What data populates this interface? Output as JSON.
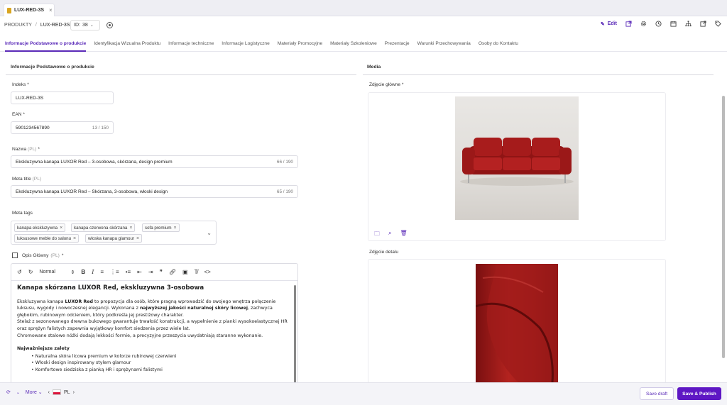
{
  "doc_tab": {
    "label": "LUX-RED-3S",
    "close": "×"
  },
  "breadcrumb": {
    "root": "PRODUKTY",
    "sep": "/",
    "current": "LUX-RED-3S"
  },
  "id_select": {
    "label": "ID:",
    "value": "38"
  },
  "toolbar": {
    "edit_label": "Edit"
  },
  "tabs": [
    {
      "label": "Informacje Podstawowe o produkcie",
      "active": true
    },
    {
      "label": "Identyfikacja Wizualna Produktu"
    },
    {
      "label": "Informacje techniczne"
    },
    {
      "label": "Informacje Logistyczne"
    },
    {
      "label": "Materiały Promocyjne"
    },
    {
      "label": "Materiały Szkoleniowe"
    },
    {
      "label": "Prezentacje"
    },
    {
      "label": "Warunki Przechowywania"
    },
    {
      "label": "Osoby do Kontaktu"
    }
  ],
  "left": {
    "section_title": "Informacje Podstawowe o produkcie",
    "indeks": {
      "label": "Indeks *",
      "value": "LUX-RED-3S"
    },
    "ean": {
      "label": "EAN *",
      "value": "5901234567890",
      "count": "13 / 150"
    },
    "nazwa": {
      "label": "Nazwa",
      "lang": "(PL)",
      "req": "*",
      "value": "Ekskluzywna kanapa LUXOR Red – 3-osobowa, skórzana, design premium",
      "count": "66 / 190"
    },
    "meta_title": {
      "label": "Meta title",
      "lang": "(PL)",
      "value": "Ekskluzywna kanapa LUXOR Red – Skórzana, 3-osobowa, włoski design",
      "count": "65 / 190"
    },
    "meta_tags": {
      "label": "Meta tags",
      "chips": [
        "kanapa ekskluzywna",
        "kanapa czerwona skórzana",
        "sofa premium",
        "luksusowe meble do salonu",
        "włoska kanapa glamour"
      ]
    },
    "opis": {
      "label": "Opis Główny",
      "lang": "(PL)",
      "req": "*"
    },
    "editor": {
      "format": "Normal",
      "heading": "Kanapa skórzana LUXOR Red, ekskluzywna 3-osobowa",
      "p1_a": "Ekskluzywna kanapa ",
      "p1_b": "LUXOR Red",
      "p1_c": " to propozycja dla osób, które pragną wprowadzić do swojego wnętrza połączenie luksusu, wygody i nowoczesnej elegancji. Wykonana z ",
      "p1_d": "najwyższej jakości naturalnej skóry licowej",
      "p1_e": ", zachwyca głębokim, rubinowym odcieniem, który podkreśla jej prestiżowy charakter.",
      "p2": "Stelaż z sezonowanego drewna bukowego gwarantuje trwałość konstrukcji, a wypełnienie z pianki wysokoelastycznej HR oraz sprężyn falistych zapewnia wyjątkowy komfort siedzenia przez wiele lat.",
      "p3": "Chromowane stalowe nóżki dodają lekkości formie, a precyzyjne przeszycia uwydatniają staranne wykonanie.",
      "h3": "Najważniejsze zalety",
      "bullets": [
        "Naturalna skóra licowa premium w kolorze rubinowej czerwieni",
        "Włoski design inspirowany stylem glamour",
        "Komfortowe siedziska z pianką HR i sprężynami falistymi"
      ]
    }
  },
  "right": {
    "section_title": "Media",
    "main_photo": {
      "label": "Zdjęcie główne *"
    },
    "detail_photo": {
      "label": "Zdjęcie detalu"
    }
  },
  "footer": {
    "more": "More",
    "lang": "PL",
    "save_draft": "Save draft",
    "save_publish": "Save & Publish"
  },
  "colors": {
    "accent": "#5e17c4",
    "sofa": "#a81c1c"
  }
}
